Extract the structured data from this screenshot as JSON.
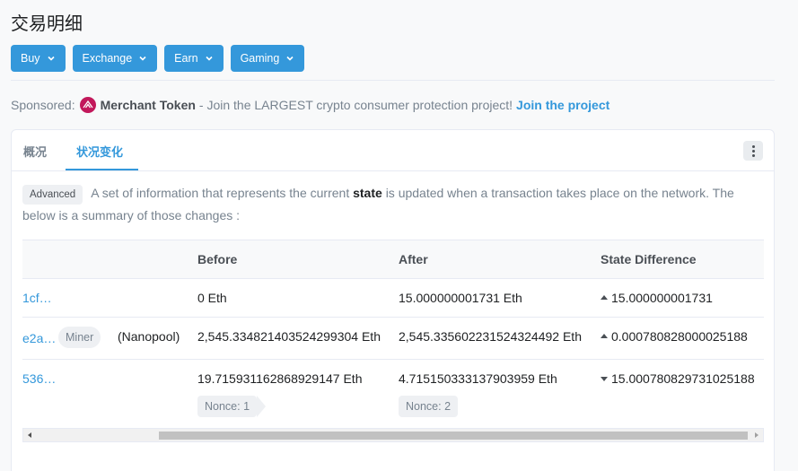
{
  "page": {
    "title": "交易明细"
  },
  "menu": {
    "buttons": [
      {
        "label": "Buy"
      },
      {
        "label": "Exchange"
      },
      {
        "label": "Earn"
      },
      {
        "label": "Gaming"
      }
    ]
  },
  "sponsor": {
    "prefix": "Sponsored:",
    "brand": "Merchant Token",
    "text": "- Join the LARGEST crypto consumer protection project!",
    "link": "Join the project",
    "logo_color": "#c2185b"
  },
  "tabs": [
    {
      "label": "概况",
      "active": false
    },
    {
      "label": "状况变化",
      "active": true
    }
  ],
  "description": {
    "badge": "Advanced",
    "text_before": "A set of information that represents the current",
    "bold": "state",
    "text_after": "is updated when a transaction takes place on the network. The below is a summary of those changes :"
  },
  "table": {
    "headers": {
      "before": "Before",
      "after": "After",
      "diff": "State Difference"
    },
    "rows": [
      {
        "address": "1cf…",
        "tag": "",
        "tag_note": "",
        "before": "0 Eth",
        "after": "15.000000001731 Eth",
        "diff": "15.000000001731",
        "direction": "up",
        "before_nonce": "",
        "after_nonce": ""
      },
      {
        "address": "e2a…",
        "tag": "Miner",
        "tag_note": "(Nanopool)",
        "before": "2,545.334821403524299304 Eth",
        "after": "2,545.335602231524324492 Eth",
        "diff": "0.000780828000025188",
        "direction": "up",
        "before_nonce": "",
        "after_nonce": ""
      },
      {
        "address": "536…",
        "tag": "",
        "tag_note": "",
        "before": "19.715931162868929147 Eth",
        "after": "4.715150333137903959 Eth",
        "diff": "15.000780829731025188",
        "direction": "down",
        "before_nonce": "Nonce: 1",
        "after_nonce": "Nonce: 2"
      }
    ]
  },
  "colors": {
    "accent": "#3498db",
    "text": "#1e2022",
    "muted": "#77838f"
  }
}
